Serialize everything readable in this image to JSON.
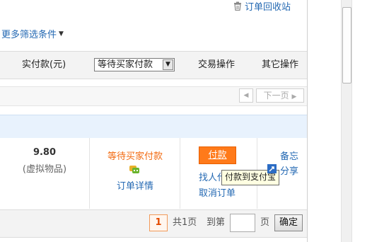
{
  "top": {
    "recycle_label": "订单回收站"
  },
  "filter": {
    "more_label": "更多筛选条件"
  },
  "table_header": {
    "paid": "实付款(元)",
    "status_selected": "等待买家付款",
    "actions": "交易操作",
    "other": "其它操作"
  },
  "pager_top": {
    "next_label": "下一页"
  },
  "order": {
    "price": "9.80",
    "product_type": "(虚拟物品)",
    "status": "等待买家付款",
    "detail_link": "订单详情",
    "pay_button": "付款",
    "find_pay_link": "找人代付",
    "cancel_link": "取消订单",
    "tooltip": "付款到支付宝",
    "memo_link": "备忘",
    "share_link": "分享"
  },
  "pagination": {
    "current_page": "1",
    "total_label": "共1页",
    "goto_label": "到第",
    "page_unit": "页",
    "confirm_button": "确定",
    "page_input_value": ""
  },
  "colors": {
    "link": "#2469b3",
    "status_orange": "#f26a10",
    "pay_button": "#ff7a1a"
  }
}
